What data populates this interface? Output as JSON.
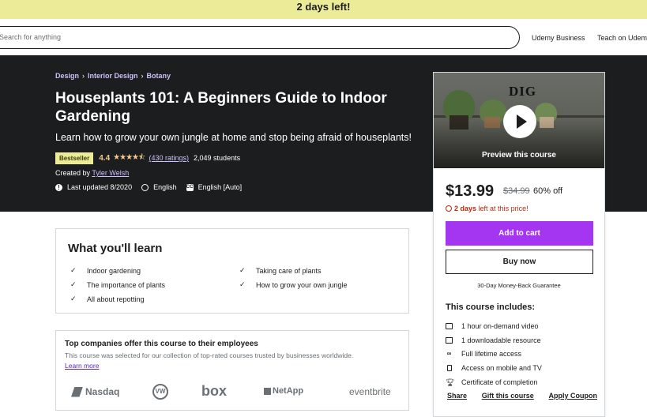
{
  "banner": {
    "text": "2 days left!"
  },
  "header": {
    "search_placeholder": "Search for anything",
    "nav": [
      "Udemy Business",
      "Teach on Udemy"
    ]
  },
  "course": {
    "breadcrumbs": [
      "Design",
      "Interior Design",
      "Botany"
    ],
    "title": "Houseplants 101: A Beginners Guide to Indoor Gardening",
    "subtitle": "Learn how to grow your own jungle at home and stop being afraid of houseplants!",
    "badge": "Bestseller",
    "rating": "4.4",
    "stars": "★★★★⯪",
    "ratings_count": "(430 ratings)",
    "students": "2,049 students",
    "created_by_label": "Created by",
    "instructor": "Tyler Welsh",
    "last_updated": "Last updated 8/2020",
    "language": "English",
    "captions": "English [Auto]"
  },
  "sidebar": {
    "preview_logo": "DIG",
    "preview_label": "Preview this course",
    "price": "$13.99",
    "original_price": "$34.99",
    "discount": "60% off",
    "timer_bold": "2 days",
    "timer_rest": "left at this price!",
    "add_to_cart": "Add to cart",
    "buy_now": "Buy now",
    "guarantee": "30-Day Money-Back Guarantee",
    "includes_title": "This course includes:",
    "includes": [
      {
        "icon": "video-icon",
        "label": "1 hour on-demand video"
      },
      {
        "icon": "file-icon",
        "label": "1 downloadable resource"
      },
      {
        "icon": "infinity-icon",
        "label": "Full lifetime access"
      },
      {
        "icon": "mobile-icon",
        "label": "Access on mobile and TV"
      },
      {
        "icon": "trophy-icon",
        "label": "Certificate of completion"
      }
    ],
    "actions": [
      "Share",
      "Gift this course",
      "Apply Coupon"
    ]
  },
  "learn": {
    "title": "What you'll learn",
    "items": [
      "Indoor gardening",
      "Taking care of plants",
      "The importance of plants",
      "How to grow your own jungle",
      "All about repotting"
    ]
  },
  "companies": {
    "title": "Top companies offer this course to their employees",
    "description": "This course was selected for our collection of top-rated courses trusted by businesses worldwide.",
    "link": "Learn more",
    "logos": [
      "Nasdaq",
      "VW",
      "box",
      "NetApp",
      "eventbrite"
    ]
  },
  "colors": {
    "accent": "#a435f0",
    "banner": "#eceb98",
    "hero_bg": "#1c1d1f",
    "link_light": "#cec0fc",
    "timer": "#b32d0f"
  }
}
